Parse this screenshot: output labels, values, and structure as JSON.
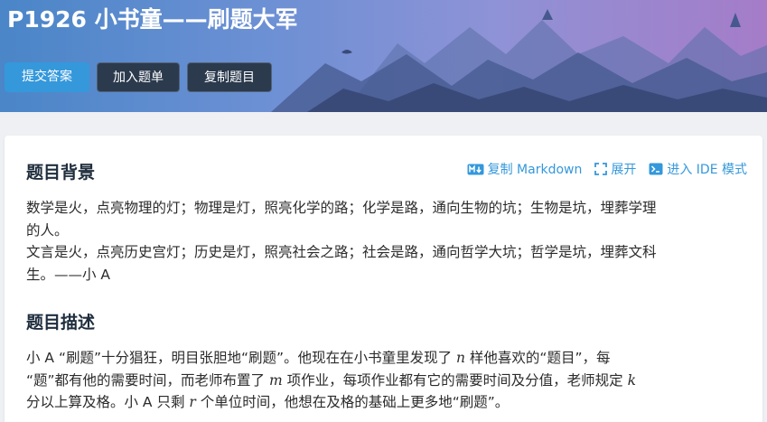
{
  "problem": {
    "title": "P1926 小书童——刷题大军"
  },
  "actions": {
    "submit_label": "提交答案",
    "add_to_list_label": "加入题单",
    "copy_problem_label": "复制题目"
  },
  "toolbar": {
    "copy_markdown_label": "复制 Markdown",
    "expand_label": "展开",
    "ide_mode_label": "进入 IDE 模式"
  },
  "background": {
    "heading": "题目背景",
    "line1": "数学是火，点亮物理的灯；物理是灯，照亮化学的路；化学是路，通向生物的坑；生物是坑，埋葬学理",
    "line2": "的人。",
    "line3": "文言是火，点亮历史宫灯；历史是灯，照亮社会之路；社会是路，通向哲学大坑；哲学是坑，埋葬文科",
    "line4": "生。——小 A"
  },
  "description": {
    "heading": "题目描述",
    "l1_a": "小 A “刷题”十分猖狂，明目张胆地“刷题”。他现在在小书童里发现了 ",
    "l1_var": "n",
    "l1_b": " 样他喜欢的“题目”，每",
    "l2_a": "“题”都有他的需要时间，而老师布置了 ",
    "l2_var": "m",
    "l2_b": " 项作业，每项作业都有它的需要时间及分值，老师规定 ",
    "l2_var2": "k",
    "l3_a": "分以上算及格。小 A 只剩 ",
    "l3_var": "r",
    "l3_b": " 个单位时间，他想在及格的基础上更多地“刷题”。"
  },
  "colors": {
    "accent": "#3498db",
    "dark_button": "#2b3a4d",
    "banner_left": "#4a86c8",
    "banner_right": "#a57cc8"
  }
}
